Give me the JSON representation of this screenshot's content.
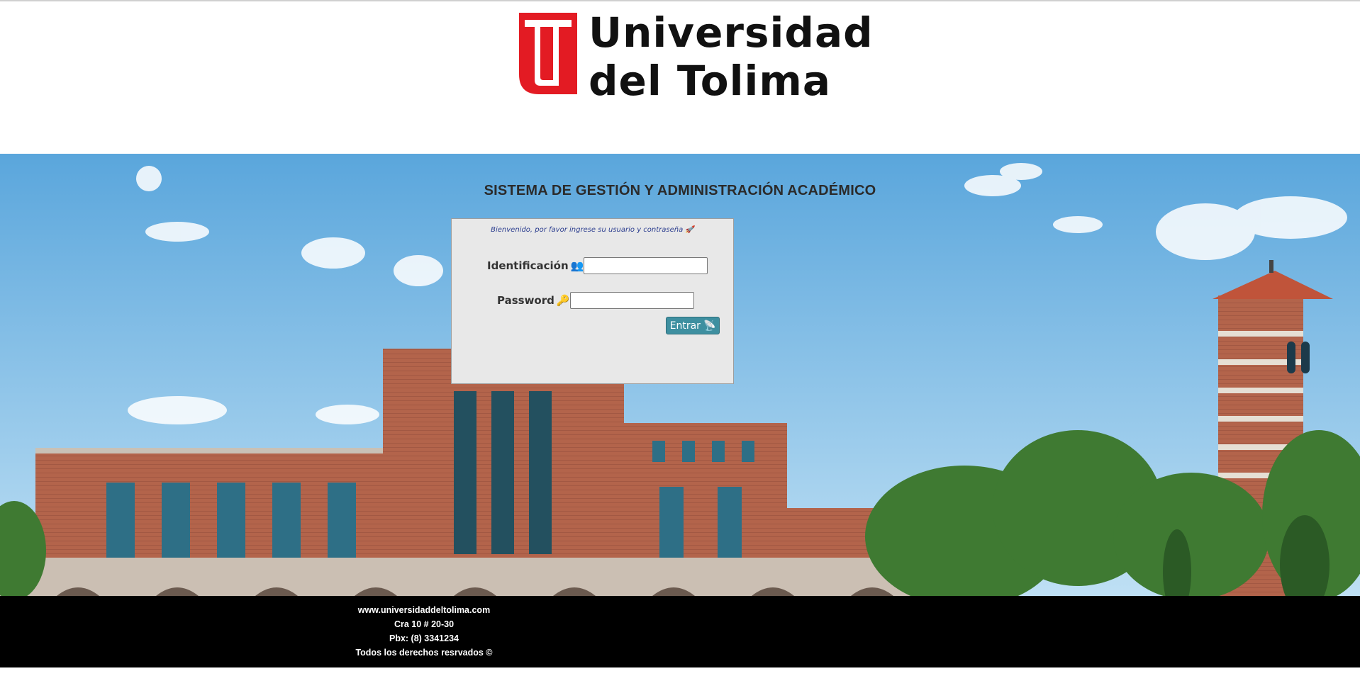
{
  "header": {
    "logo_line1": "Universidad",
    "logo_line2": "del Tolima",
    "brand_color": "#e31b23"
  },
  "main": {
    "title": "SISTEMA DE GESTIÓN Y ADMINISTRACIÓN ACADÉMICO"
  },
  "login": {
    "welcome": "Bienvenido, por favor ingrese su usuario y contraseña 🚀",
    "id_label": "Identificación",
    "id_icon": "👥",
    "id_value": "",
    "password_label": "Password",
    "password_icon": "🔑",
    "password_value": "",
    "submit_label": "Entrar",
    "submit_icon": "📡",
    "button_color": "#3e8fa0"
  },
  "footer": {
    "website": "www.universidaddeltolima.com",
    "address": "Cra 10 # 20-30",
    "phone": "Pbx: (8) 3341234",
    "rights": "Todos los derechos resrvados ©"
  }
}
